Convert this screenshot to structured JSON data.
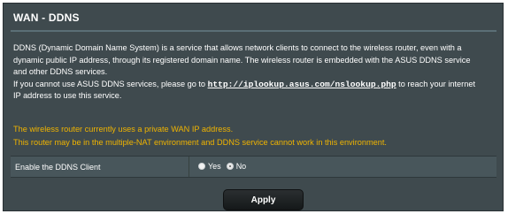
{
  "section": {
    "title": "WAN - DDNS"
  },
  "description": {
    "line1": "DDNS (Dynamic Domain Name System) is a service that allows network clients to connect to the wireless router, even with a",
    "line2": "dynamic public IP address, through its registered domain name. The wireless router is embedded with the ASUS DDNS service",
    "line3": "and other DDNS services.",
    "line4_prefix": "If you cannot use ASUS DDNS services, please go to ",
    "link_text": "http://iplookup.asus.com/nslookup.php",
    "line4_suffix": " to reach your internet",
    "line5": "IP address to use this service."
  },
  "warnings": {
    "line1": "The wireless router currently uses a private WAN IP address.",
    "line2": "This router may be in the multiple-NAT environment and DDNS service cannot work in this environment."
  },
  "ddns_setting": {
    "label": "Enable the DDNS Client",
    "option_yes": "Yes",
    "option_no": "No",
    "selected": "No"
  },
  "actions": {
    "apply_label": "Apply"
  },
  "colors": {
    "panel_bg": "#3f4a4e",
    "warning_text": "#f0b400",
    "divider": "#5b6f76"
  }
}
